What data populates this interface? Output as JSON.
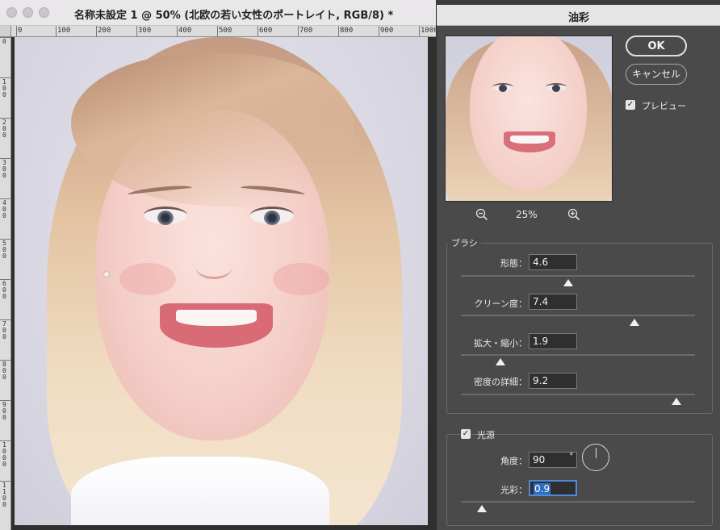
{
  "document": {
    "title": "名称未設定 1 @ 50% (北欧の若い女性のポートレイト, RGB/8) *",
    "ruler_top_labels": [
      "0",
      "100",
      "200",
      "300",
      "400",
      "500",
      "600",
      "700",
      "800",
      "900",
      "1000"
    ],
    "ruler_left_labels": [
      "0",
      "100",
      "200",
      "300",
      "400",
      "500",
      "600",
      "700",
      "800",
      "900",
      "1000",
      "1100"
    ]
  },
  "dialog": {
    "title": "油彩",
    "ok_label": "OK",
    "cancel_label": "キャンセル",
    "preview_label": "プレビュー",
    "preview_checked": true,
    "zoom_level": "25%",
    "brush": {
      "title": "ブラシ",
      "params": [
        {
          "label": "形態：",
          "value": "4.6",
          "fraction": 0.46
        },
        {
          "label": "クリーン度：",
          "value": "7.4",
          "fraction": 0.74
        },
        {
          "label": "拡大・縮小：",
          "value": "1.9",
          "fraction": 0.17
        },
        {
          "label": "密度の詳細：",
          "value": "9.2",
          "fraction": 0.92
        }
      ]
    },
    "lighting": {
      "title": "光源",
      "checked": true,
      "angle_label": "角度：",
      "angle_value": "90",
      "degree_symbol": "°",
      "shine_label": "光彩：",
      "shine_value": "0.9",
      "shine_fraction": 0.09
    }
  },
  "colors": {
    "dialog_bg": "#4a4a4a",
    "selection": "#2f6fc2",
    "focus_ring": "#4d8bd6"
  },
  "icons": [
    "zoom-out-icon",
    "zoom-in-icon",
    "checkbox-checked-icon",
    "angle-dial-icon"
  ]
}
